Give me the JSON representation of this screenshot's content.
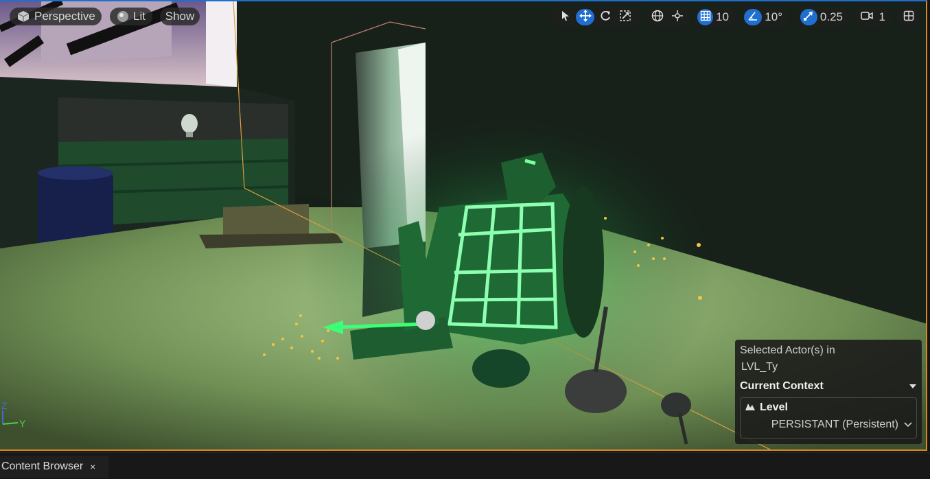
{
  "viewport": {
    "view_mode": "Perspective",
    "lighting": "Lit",
    "show": "Show"
  },
  "toolbar": {
    "grid_snap": "10",
    "rotation_snap": "10°",
    "scale_snap": "0.25",
    "camera_speed": "1"
  },
  "context_panel": {
    "line1": "Selected Actor(s) in",
    "line2": "LVL_Ty",
    "current_context": "Current Context",
    "level_label": "Level",
    "level_value": "PERSISTANT (Persistent)"
  },
  "axis": {
    "z": "Z",
    "y": "Y"
  },
  "bottom_tabs": {
    "content_browser": "Content Browser",
    "close": "×"
  },
  "colors": {
    "accent": "#1f6fd1",
    "selection": "#d98a1e",
    "glow": "#39ff6a"
  }
}
